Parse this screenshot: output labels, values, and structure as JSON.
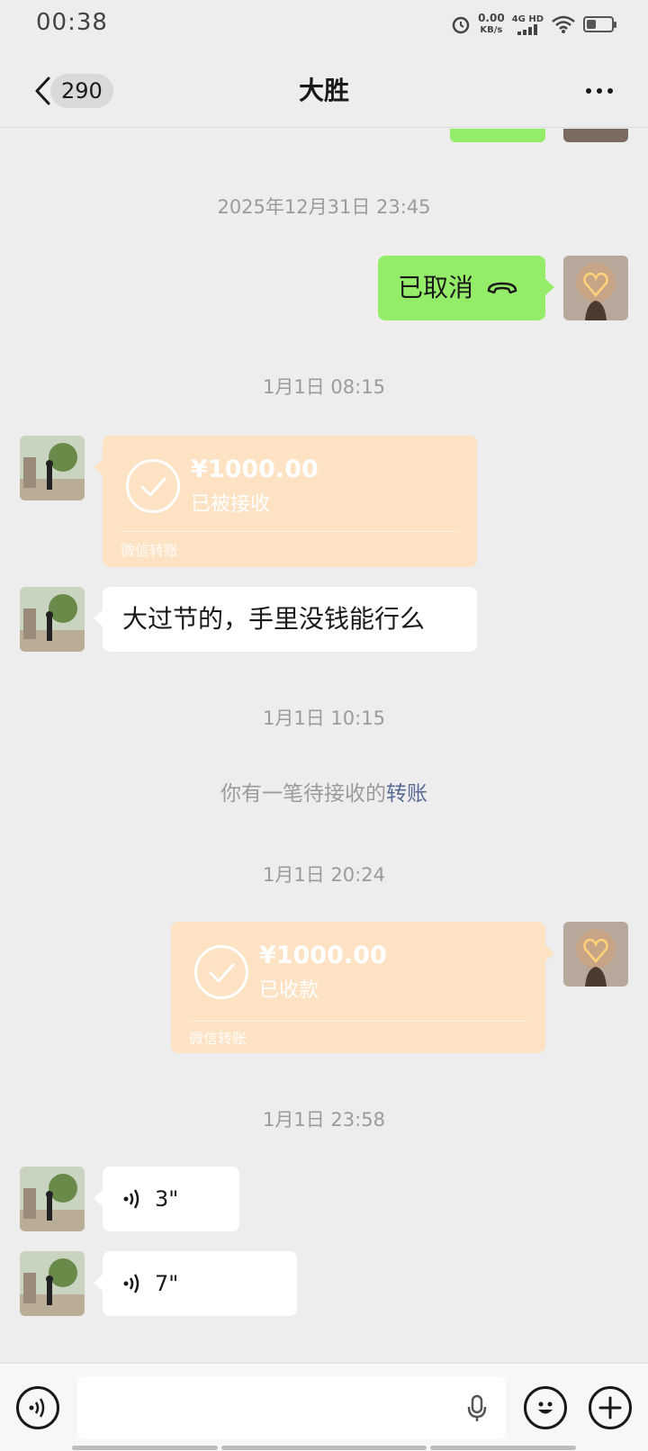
{
  "status_bar": {
    "time": "00:38",
    "net_speed_value": "0.00",
    "net_speed_unit": "KB/s",
    "network_label": "4G HD",
    "battery_level_percent": 40
  },
  "header": {
    "unread_count": "290",
    "title": "大胜"
  },
  "messages": {
    "stamp1": "2025年12月31日 23:45",
    "call_cancelled": "已取消",
    "stamp2": "1月1日 08:15",
    "transfer1": {
      "amount": "¥1000.00",
      "status": "已被接收",
      "footer": "微信转账"
    },
    "text1": "大过节的，手里没钱能行么",
    "stamp3": "1月1日 10:15",
    "system_notice": "你有一笔待接收的",
    "system_link": "转账",
    "stamp4": "1月1日 20:24",
    "transfer2": {
      "amount": "¥1000.00",
      "status": "已收款",
      "footer": "微信转账"
    },
    "stamp5": "1月1日 23:58",
    "voice1": "3\"",
    "voice2": "7\""
  },
  "colors": {
    "chat_background": "#ededed",
    "self_bubble": "#95ec69",
    "other_bubble": "#ffffff",
    "transfer_card": "#fde2c4",
    "link": "#576b95"
  }
}
